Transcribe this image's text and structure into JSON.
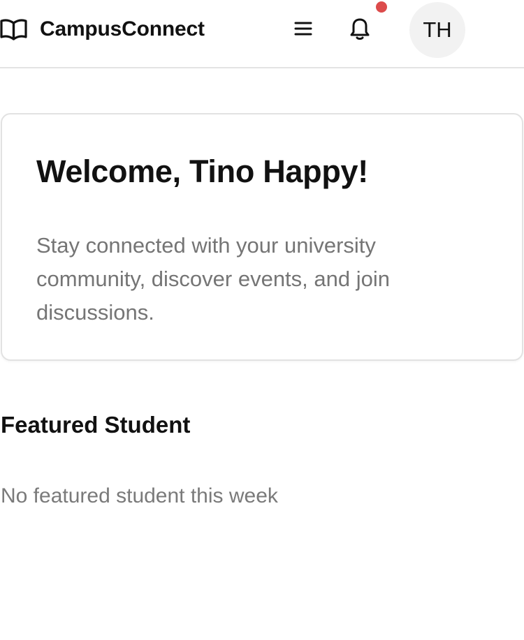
{
  "app": {
    "name": "CampusConnect",
    "brand_icon": "book-open-icon"
  },
  "header": {
    "menu_icon": "menu-icon",
    "notification_icon": "bell-icon",
    "notification_dot_color": "#dc4b4b",
    "avatar_initials": "TH"
  },
  "welcome": {
    "title": "Welcome, Tino Happy!",
    "message": "Stay connected with your university community, discover events, and join discussions."
  },
  "featured_student": {
    "heading": "Featured Student",
    "empty_message": "No featured student this week"
  }
}
